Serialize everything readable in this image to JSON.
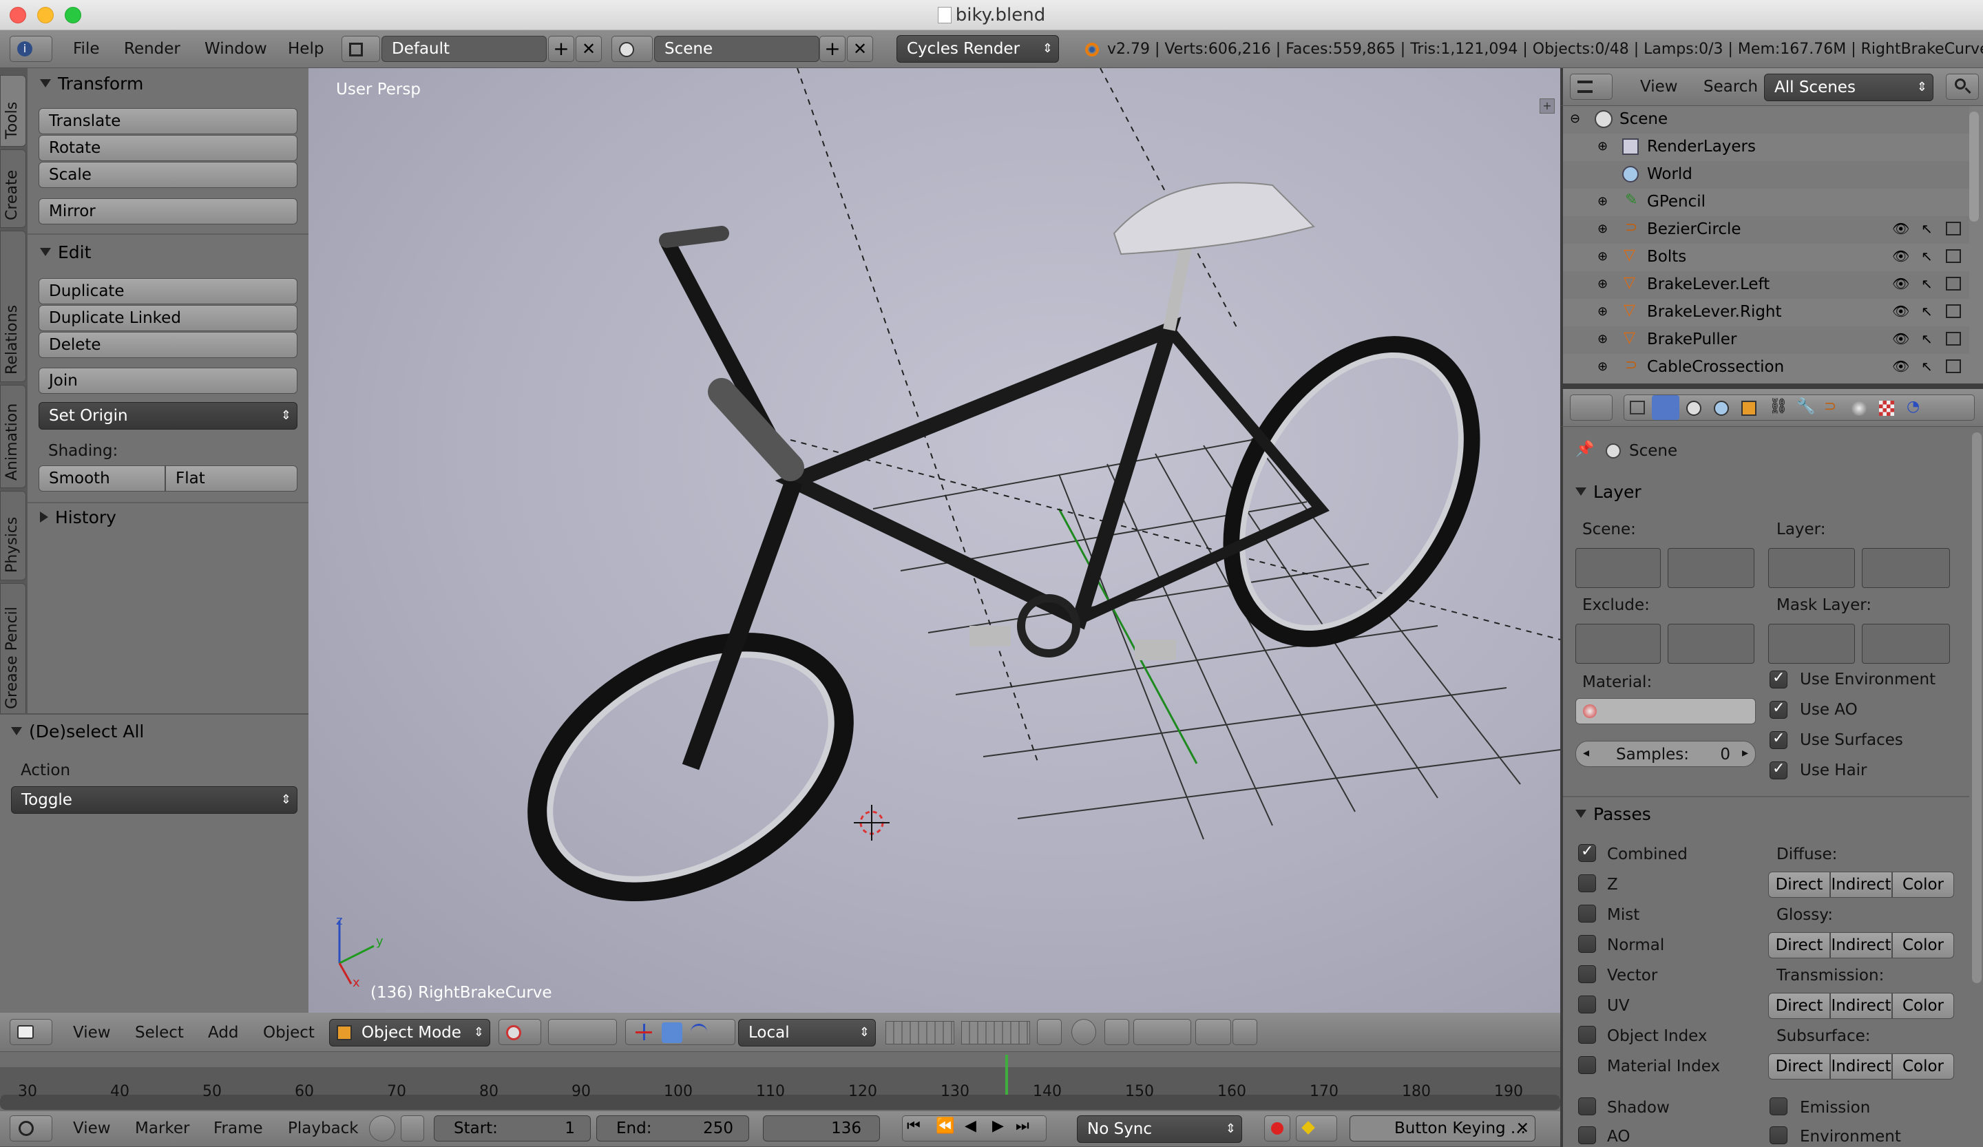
{
  "window": {
    "title": "biky.blend"
  },
  "topbar": {
    "menus": [
      "File",
      "Render",
      "Window",
      "Help"
    ],
    "layout": "Default",
    "scene": "Scene",
    "render_engine": "Cycles Render",
    "stats": "v2.79 | Verts:606,216 | Faces:559,865 | Tris:1,121,094 | Objects:0/48 | Lamps:0/3 | Mem:167.76M | RightBrakeCurve"
  },
  "tool_tabs": [
    "Tools",
    "Create",
    "Relations",
    "Animation",
    "Physics",
    "Grease Pencil"
  ],
  "tools": {
    "transform_header": "Transform",
    "translate": "Translate",
    "rotate": "Rotate",
    "scale": "Scale",
    "mirror": "Mirror",
    "edit_header": "Edit",
    "duplicate": "Duplicate",
    "duplicate_linked": "Duplicate Linked",
    "delete": "Delete",
    "join": "Join",
    "set_origin": "Set Origin",
    "shading_label": "Shading:",
    "smooth": "Smooth",
    "flat": "Flat",
    "history_header": "History"
  },
  "operator": {
    "header": "(De)select All",
    "action_label": "Action",
    "action_value": "Toggle"
  },
  "viewport": {
    "view_label": "User Persp",
    "object_label": "(136) RightBrakeCurve",
    "axis_x": "x",
    "axis_y": "y",
    "axis_z": "z"
  },
  "view3d_header": {
    "menus": [
      "View",
      "Select",
      "Add",
      "Object"
    ],
    "mode": "Object Mode",
    "orientation": "Local"
  },
  "outliner": {
    "view": "View",
    "search": "Search",
    "filter": "All Scenes",
    "items": [
      {
        "label": "Scene"
      },
      {
        "label": "RenderLayers"
      },
      {
        "label": "World"
      },
      {
        "label": "GPencil"
      },
      {
        "label": "BezierCircle"
      },
      {
        "label": "Bolts"
      },
      {
        "label": "BrakeLever.Left"
      },
      {
        "label": "BrakeLever.Right"
      },
      {
        "label": "BrakePuller"
      },
      {
        "label": "CableCrossection"
      }
    ]
  },
  "properties": {
    "context": "Scene",
    "layer_header": "Layer",
    "scene_label": "Scene:",
    "layer_label": "Layer:",
    "exclude_label": "Exclude:",
    "mask_layer_label": "Mask Layer:",
    "material_label": "Material:",
    "samples_label": "Samples:",
    "samples_value": "0",
    "use_environment": "Use Environment",
    "use_ao": "Use AO",
    "use_surfaces": "Use Surfaces",
    "use_hair": "Use Hair",
    "passes_header": "Passes",
    "passes": {
      "combined": "Combined",
      "z": "Z",
      "mist": "Mist",
      "normal": "Normal",
      "vector": "Vector",
      "uv": "UV",
      "object_index": "Object Index",
      "material_index": "Material Index",
      "shadow": "Shadow",
      "ao": "AO",
      "emission": "Emission",
      "environment": "Environment"
    },
    "diffuse_label": "Diffuse:",
    "glossy_label": "Glossy:",
    "transmission_label": "Transmission:",
    "subsurface_label": "Subsurface:",
    "direct": "Direct",
    "indirect": "Indirect",
    "color": "Color"
  },
  "timeline": {
    "ticks": [
      "30",
      "40",
      "50",
      "60",
      "70",
      "80",
      "90",
      "100",
      "110",
      "120",
      "130",
      "140",
      "150",
      "160",
      "170",
      "180",
      "190"
    ],
    "current_frame": 136,
    "menus": [
      "View",
      "Marker",
      "Frame",
      "Playback"
    ],
    "start_label": "Start:",
    "start_value": "1",
    "end_label": "End:",
    "end_value": "250",
    "frame_value": "136",
    "sync": "No Sync",
    "keying": "Button Keying ..."
  }
}
